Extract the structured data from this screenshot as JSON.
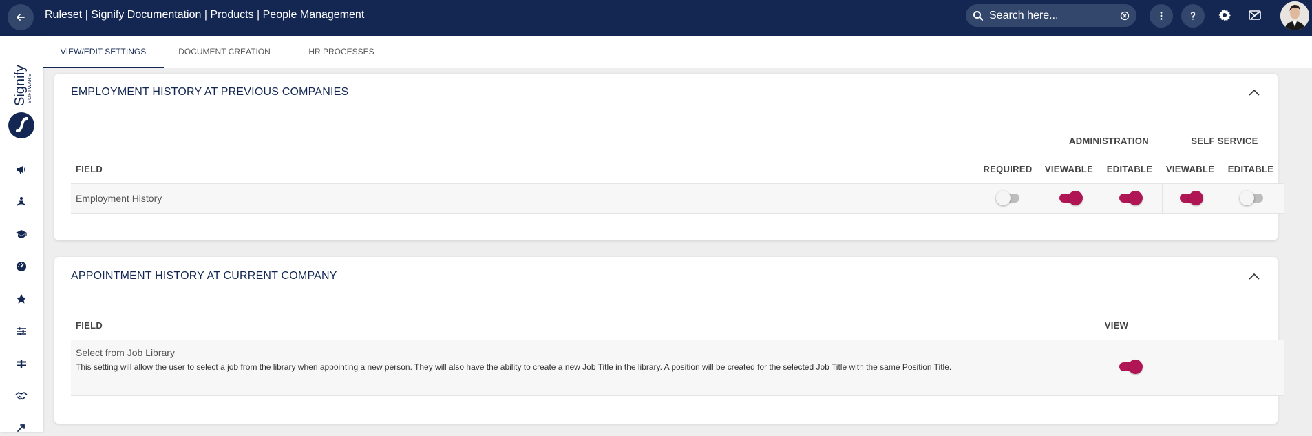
{
  "header": {
    "title": "Ruleset | Signify Documentation | Products | People Management",
    "search_placeholder": "Search here..."
  },
  "tabs": [
    {
      "label": "VIEW/EDIT SETTINGS",
      "active": true
    },
    {
      "label": "DOCUMENT CREATION",
      "active": false
    },
    {
      "label": "HR PROCESSES",
      "active": false
    }
  ],
  "brand": {
    "name": "Signify",
    "sub": "SOFTWARE"
  },
  "sections": [
    {
      "title": "EMPLOYMENT HISTORY AT PREVIOUS COMPANIES",
      "groups": [
        "ADMINISTRATION",
        "SELF SERVICE"
      ],
      "columns": [
        "FIELD",
        "REQUIRED",
        "VIEWABLE",
        "EDITABLE",
        "VIEWABLE",
        "EDITABLE"
      ],
      "rows": [
        {
          "field": "Employment History",
          "toggles": [
            false,
            true,
            true,
            true,
            false
          ]
        }
      ]
    },
    {
      "title": "APPOINTMENT HISTORY AT CURRENT COMPANY",
      "columns": [
        "FIELD",
        "VIEW"
      ],
      "rows": [
        {
          "field": "Select from Job Library",
          "description": "This setting will allow the user to select a job from the library when appointing a new person. They will also have the ability to create a new Job Title in the library. A position will be created for the selected Job Title with the same Position Title.",
          "toggles": [
            true
          ]
        }
      ]
    }
  ],
  "colors": {
    "navy": "#132752",
    "accent": "#b01654",
    "toggle_off": "#bdbdbd"
  }
}
